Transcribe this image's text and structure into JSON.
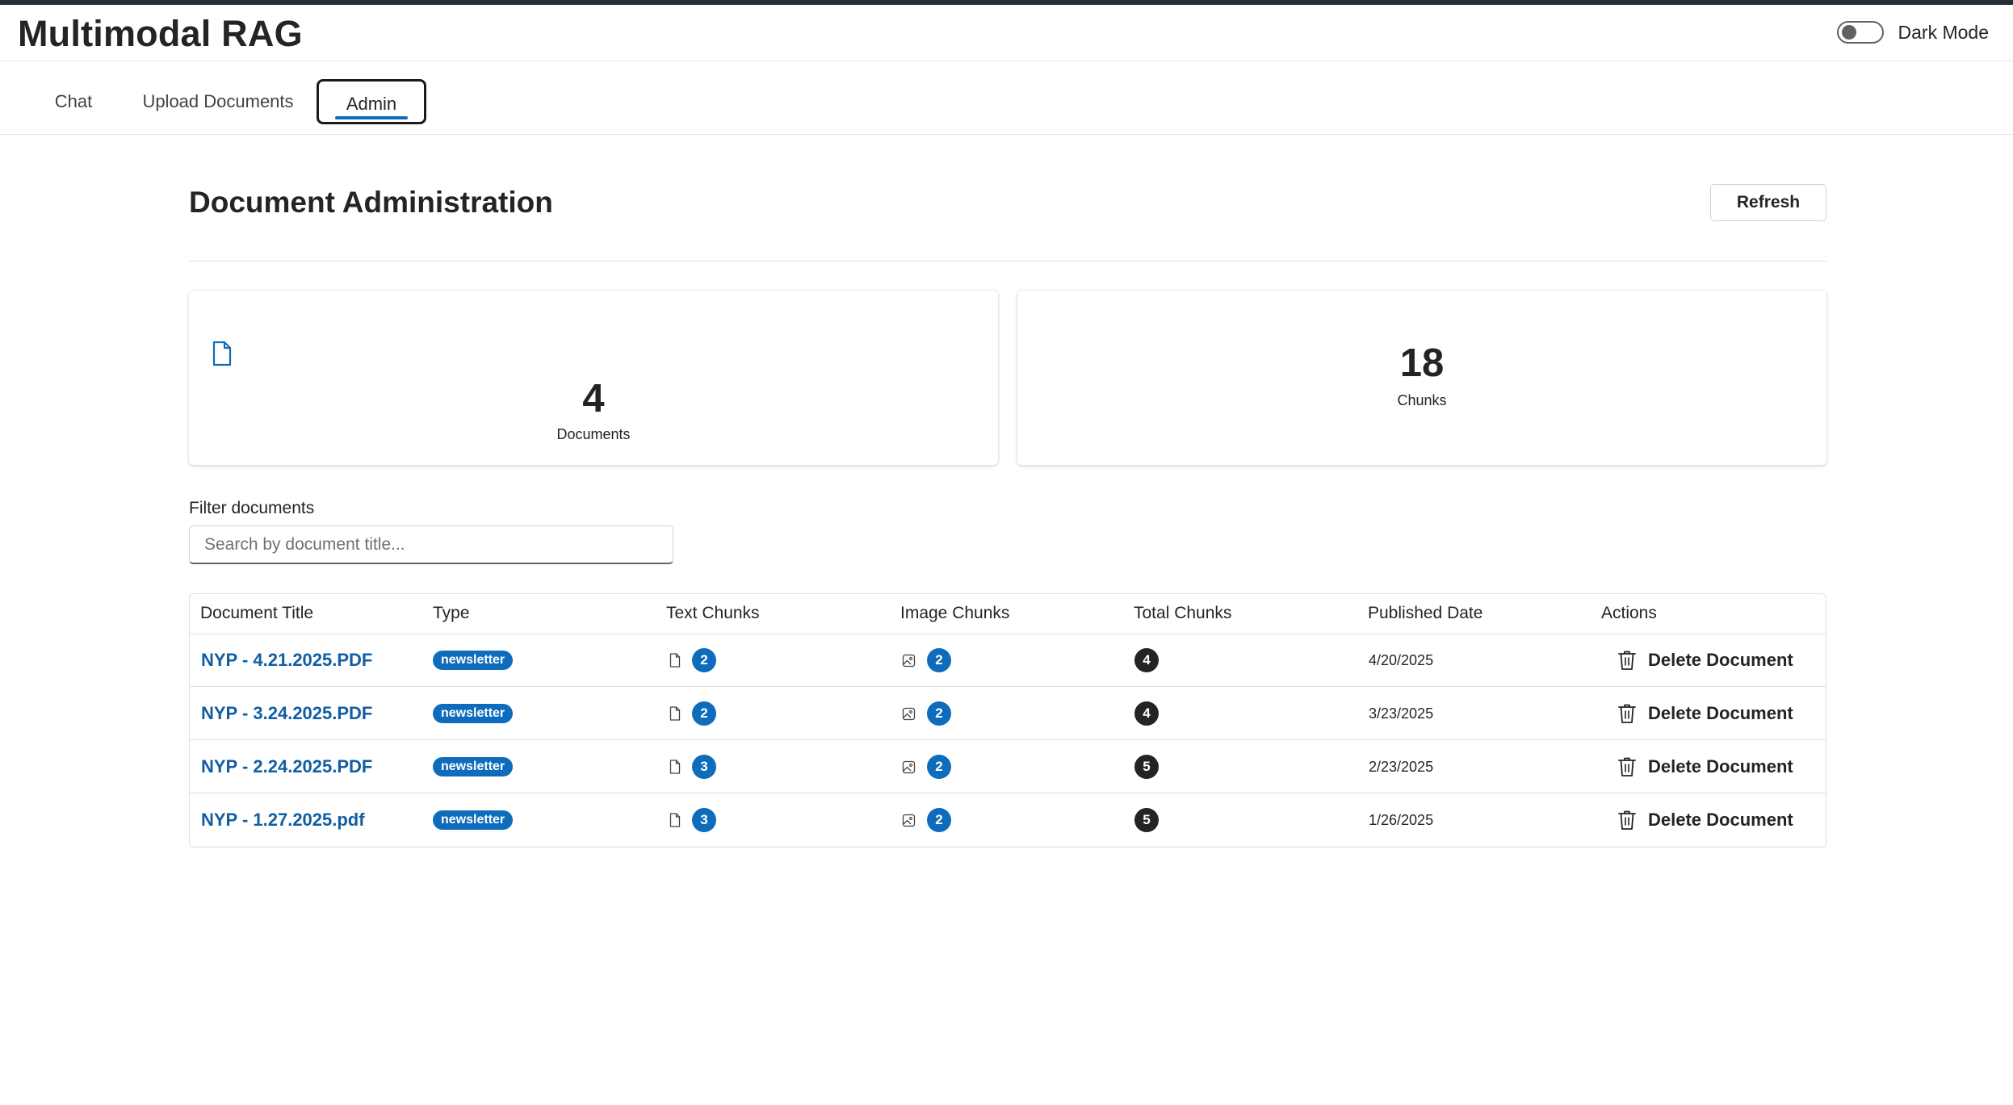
{
  "app": {
    "title": "Multimodal RAG",
    "dark_mode_label": "Dark Mode",
    "dark_mode_on": false
  },
  "tabs": [
    {
      "label": "Chat",
      "active": false
    },
    {
      "label": "Upload Documents",
      "active": false
    },
    {
      "label": "Admin",
      "active": true
    }
  ],
  "admin": {
    "title": "Document Administration",
    "refresh_label": "Refresh",
    "stats": {
      "documents": {
        "value": "4",
        "label": "Documents",
        "icon": "document-icon"
      },
      "chunks": {
        "value": "18",
        "label": "Chunks"
      }
    },
    "filter": {
      "label": "Filter documents",
      "placeholder": "Search by document title...",
      "value": ""
    },
    "table": {
      "columns": [
        "Document Title",
        "Type",
        "Text Chunks",
        "Image Chunks",
        "Total Chunks",
        "Published Date",
        "Actions"
      ],
      "rows": [
        {
          "title": "NYP - 4.21.2025.PDF",
          "type": "newsletter",
          "text_chunks": "2",
          "image_chunks": "2",
          "total_chunks": "4",
          "published": "4/20/2025",
          "action": "Delete Document"
        },
        {
          "title": "NYP - 3.24.2025.PDF",
          "type": "newsletter",
          "text_chunks": "2",
          "image_chunks": "2",
          "total_chunks": "4",
          "published": "3/23/2025",
          "action": "Delete Document"
        },
        {
          "title": "NYP - 2.24.2025.PDF",
          "type": "newsletter",
          "text_chunks": "3",
          "image_chunks": "2",
          "total_chunks": "5",
          "published": "2/23/2025",
          "action": "Delete Document"
        },
        {
          "title": "NYP - 1.27.2025.pdf",
          "type": "newsletter",
          "text_chunks": "3",
          "image_chunks": "2",
          "total_chunks": "5",
          "published": "1/26/2025",
          "action": "Delete Document"
        }
      ]
    }
  },
  "colors": {
    "accent": "#0f6cbd",
    "link": "#115ea3",
    "topbar": "#292f3a",
    "dark_badge": "#242424"
  }
}
